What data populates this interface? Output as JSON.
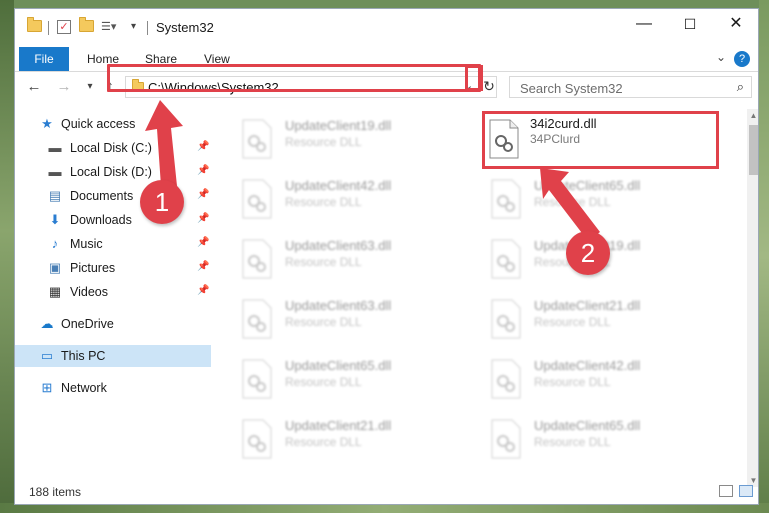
{
  "window": {
    "title": "System32",
    "controls": {
      "minimize": "—",
      "maximize": "☐",
      "close": "✕"
    }
  },
  "ribbon": {
    "tabs": [
      "File",
      "Home",
      "Share",
      "View"
    ],
    "help": "?"
  },
  "address": {
    "path": "C:\\Windows\\System32",
    "search_placeholder": "Search System32"
  },
  "sidebar": {
    "items": [
      {
        "label": "Quick access",
        "icon": "star-icon",
        "pinned": false
      },
      {
        "label": "Local Disk (C:)",
        "icon": "drive-icon",
        "pinned": true
      },
      {
        "label": "Local Disk (D:)",
        "icon": "drive-icon",
        "pinned": true
      },
      {
        "label": "Documents",
        "icon": "documents-icon",
        "pinned": true
      },
      {
        "label": "Downloads",
        "icon": "download-icon",
        "pinned": true
      },
      {
        "label": "Music",
        "icon": "music-icon",
        "pinned": true
      },
      {
        "label": "Pictures",
        "icon": "pictures-icon",
        "pinned": true
      },
      {
        "label": "Videos",
        "icon": "videos-icon",
        "pinned": true
      },
      {
        "label": "OneDrive",
        "icon": "cloud-icon",
        "pinned": false
      },
      {
        "label": "This PC",
        "icon": "computer-icon",
        "pinned": false,
        "selected": true
      },
      {
        "label": "Network",
        "icon": "network-icon",
        "pinned": false
      }
    ]
  },
  "files": {
    "left_column": [
      {
        "name": "UpdateClient19.dll",
        "type": "Resource DLL"
      },
      {
        "name": "UpdateClient42.dll",
        "type": "Resource DLL"
      },
      {
        "name": "UpdateClient63.dll",
        "type": "Resource DLL"
      },
      {
        "name": "UpdateClient63.dll",
        "type": "Resource DLL"
      },
      {
        "name": "UpdateClient65.dll",
        "type": "Resource DLL"
      },
      {
        "name": "UpdateClient21.dll",
        "type": "Resource DLL"
      }
    ],
    "right_column": [
      {
        "name": "34i2curd.dll",
        "type": "34PClurd",
        "highlighted": true
      },
      {
        "name": "UpdateClient65.dll",
        "type": "Resource DLL"
      },
      {
        "name": "UpdateClient19.dll",
        "type": "Resource DLL"
      },
      {
        "name": "UpdateClient21.dll",
        "type": "Resource DLL"
      },
      {
        "name": "UpdateClient42.dll",
        "type": "Resource DLL"
      },
      {
        "name": "UpdateClient65.dll",
        "type": "Resource DLL"
      }
    ]
  },
  "status": {
    "item_count": "188 items"
  },
  "annotations": {
    "marker1": "1",
    "marker2": "2",
    "color": "#e0414a"
  },
  "colors": {
    "accent": "#1979ca",
    "selection": "#cce4f7",
    "folder": "#f4c95d"
  }
}
